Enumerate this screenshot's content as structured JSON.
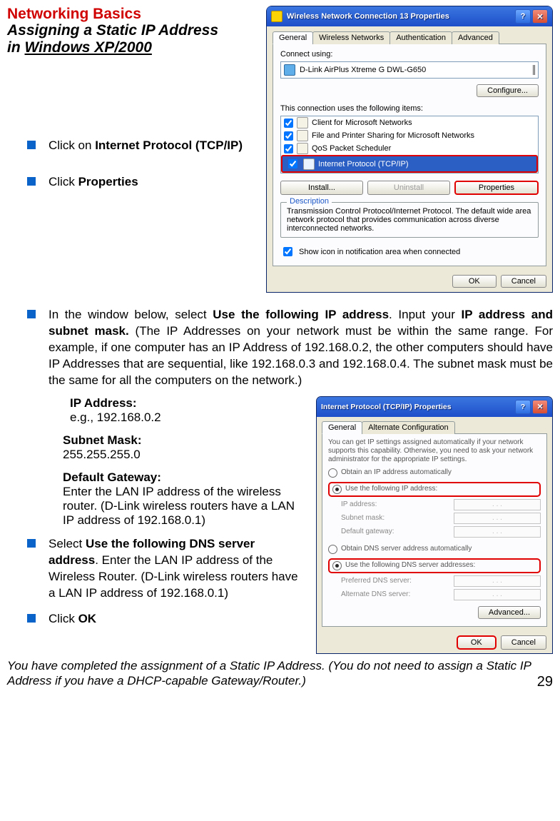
{
  "headings": {
    "title": "Networking Basics",
    "sub_line1": "Assigning a Static IP Address",
    "sub_line2_prefix": "in ",
    "sub_line2_uline": "Windows XP/2000"
  },
  "top_bullets": {
    "b1_pre": "Click on ",
    "b1_bold": "Internet Protocol (TCP/IP)",
    "b2_pre": "Click ",
    "b2_bold": "Properties"
  },
  "dialog1": {
    "title": "Wireless Network Connection 13 Properties",
    "help_btn": "?",
    "close_btn": "✕",
    "tabs": {
      "t1": "General",
      "t2": "Wireless Networks",
      "t3": "Authentication",
      "t4": "Advanced"
    },
    "connect_using_label": "Connect using:",
    "adapter": "D-Link AirPlus Xtreme G DWL-G650",
    "configure_btn": "Configure...",
    "uses_items_label": "This connection uses the following items:",
    "items": {
      "i1": "Client for Microsoft Networks",
      "i2": "File and Printer Sharing for Microsoft Networks",
      "i3": "QoS Packet Scheduler",
      "i4": "Internet Protocol (TCP/IP)"
    },
    "install_btn": "Install...",
    "uninstall_btn": "Uninstall",
    "properties_btn": "Properties",
    "desc_legend": "Description",
    "desc_text": "Transmission Control Protocol/Internet Protocol. The default wide area network protocol that provides communication across diverse interconnected networks.",
    "show_icon_label": "Show icon in notification area when connected",
    "ok_btn": "OK",
    "cancel_btn": "Cancel"
  },
  "wide_bullet": {
    "pre1": "In the window below, select ",
    "b1": "Use the following IP address",
    "mid1": ". Input your ",
    "b2": "IP address and subnet mask.",
    "rest": " (The IP Addresses on your network must be within the same range. For example, if one computer has an IP Address of 192.168.0.2, the other computers should have IP Addresses that are sequential, like 192.168.0.3 and 192.168.0.4.  The subnet mask must be the same for all the computers on the network.)"
  },
  "ip_block": {
    "ip_label": "IP Address:",
    "ip_val": "e.g., 192.168.0.2",
    "sm_label": "Subnet Mask:",
    "sm_val": "255.255.255.0",
    "gw_label": "Default Gateway:",
    "gw_val": "Enter the LAN IP address of the wireless router. (D-Link wireless routers have a LAN IP address of 192.168.0.1)"
  },
  "bullets2": {
    "b1_pre": "Select ",
    "b1_bold": "Use the following DNS server address",
    "b1_rest": ".  Enter the LAN IP address of the Wireless Router.  (D-Link wireless routers have a LAN IP address of 192.168.0.1)",
    "b2_pre": "Click ",
    "b2_bold": "OK"
  },
  "dialog2": {
    "title": "Internet Protocol (TCP/IP) Properties",
    "help_btn": "?",
    "close_btn": "✕",
    "tabs": {
      "t1": "General",
      "t2": "Alternate Configuration"
    },
    "blurb": "You can get IP settings assigned automatically if your network supports this capability. Otherwise, you need to ask your network administrator for the appropriate IP settings.",
    "r1": "Obtain an IP address automatically",
    "r2": "Use the following IP address:",
    "f_ip": "IP address:",
    "f_sm": "Subnet mask:",
    "f_gw": "Default gateway:",
    "r3": "Obtain DNS server address automatically",
    "r4": "Use the following DNS server addresses:",
    "f_pd": "Preferred DNS server:",
    "f_ad": "Alternate DNS server:",
    "adv_btn": "Advanced...",
    "ok_btn": "OK",
    "cancel_btn": "Cancel"
  },
  "footer": {
    "note": "You have completed the assignment of a Static IP Address.  (You do not need to assign a Static IP Address if you have a DHCP-capable Gateway/Router.)",
    "page": "29"
  }
}
